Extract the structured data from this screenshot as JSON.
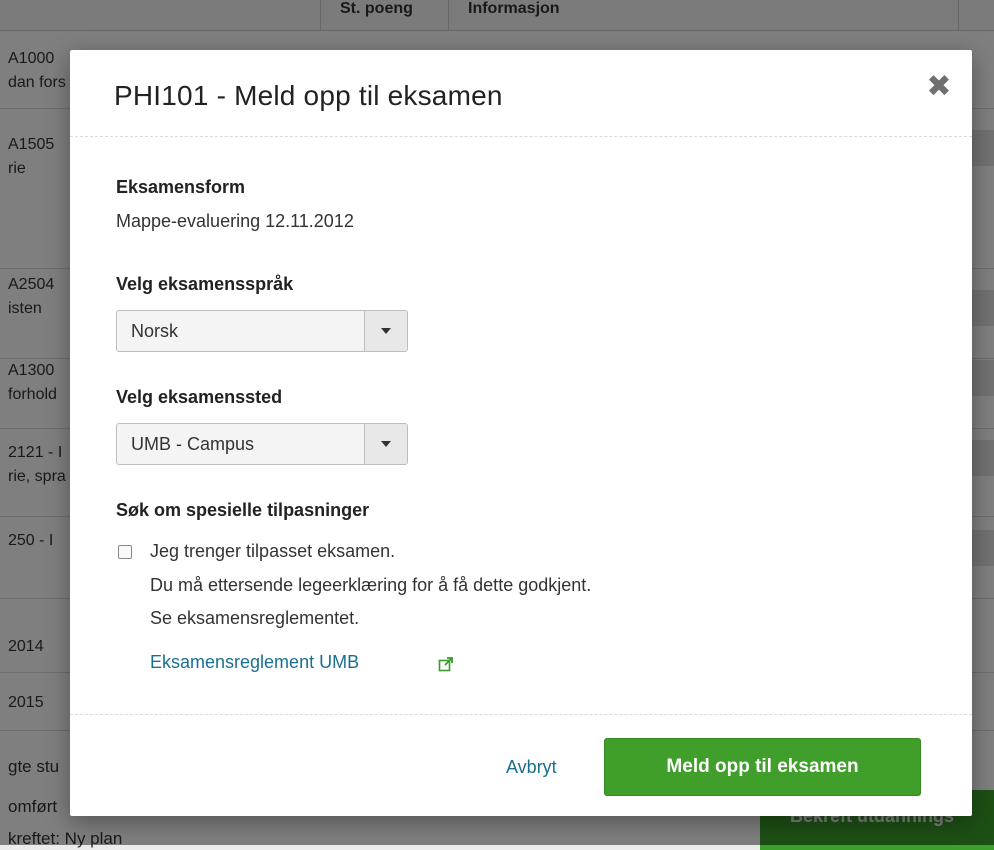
{
  "background": {
    "header": [
      "St. poeng",
      "Informasjon"
    ],
    "rows": [
      {
        "line1": "A1000",
        "line2": "dan fors"
      },
      {
        "line1": "A1505",
        "line2": "rie"
      },
      {
        "line1": "A2504",
        "line2": "isten"
      },
      {
        "line1": "A1300",
        "line2": "forhold"
      },
      {
        "line1": "2121 - I",
        "line2": "rie, spra"
      },
      {
        "line1": "250 - I",
        "line2": ""
      },
      {
        "line1": "2014",
        "line2": ""
      },
      {
        "line1": "2015",
        "line2": ""
      }
    ],
    "footer_lines": [
      "gte stu",
      "omført",
      "kreftet: Ny plan"
    ],
    "confirm_button": "Bekreft utdannings"
  },
  "modal": {
    "title": "PHI101 - Meld opp til eksamen",
    "close_icon": "close-icon",
    "exam_form": {
      "label": "Eksamensform",
      "value": "Mappe-evaluering 12.11.2012"
    },
    "language": {
      "label": "Velg eksamensspråk",
      "selected": "Norsk"
    },
    "location": {
      "label": "Velg eksamenssted",
      "selected": "UMB - Campus"
    },
    "special": {
      "label": "Søk om spesielle tilpasninger",
      "checkbox_label": "Jeg trenger  tilpasset eksamen.",
      "note_line1": "Du må ettersende legeerklæring for å få dette godkjent.",
      "note_line2": "Se eksamensreglementet.",
      "link_text": "Eksamensreglement UMB",
      "link_icon": "external-link-icon"
    },
    "footer": {
      "cancel": "Avbryt",
      "submit": "Meld opp til eksamen"
    }
  },
  "colors": {
    "primary": "#3f9f2a",
    "link": "#1a6f8f"
  }
}
